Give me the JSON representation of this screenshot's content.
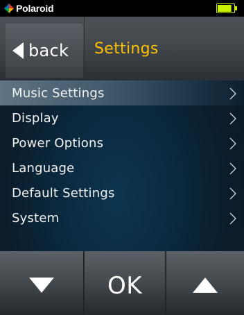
{
  "statusbar": {
    "brand": "Polaroid",
    "battery_level": 0.85,
    "battery_color": "#c8f000"
  },
  "header": {
    "back_label": "back",
    "title": "Settings",
    "title_color": "#ffc000"
  },
  "menu": {
    "items": [
      {
        "label": "Music Settings",
        "selected": true
      },
      {
        "label": "Display"
      },
      {
        "label": "Power Options"
      },
      {
        "label": "Language"
      },
      {
        "label": "Default Settings"
      },
      {
        "label": "System"
      }
    ]
  },
  "bottombar": {
    "down_icon": "down-triangle-icon",
    "ok_label": "OK",
    "up_icon": "up-triangle-icon"
  }
}
